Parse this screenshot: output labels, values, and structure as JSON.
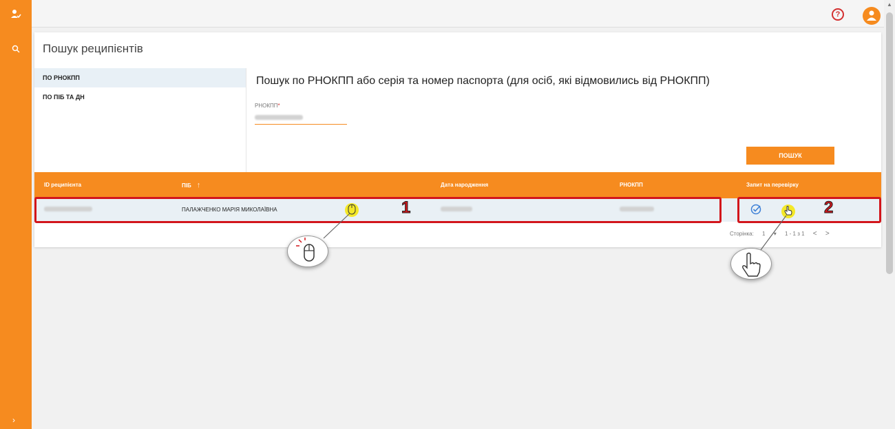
{
  "nav": {
    "search_icon": "search-icon",
    "expand_icon": "chevron-right-icon"
  },
  "header": {
    "help_label": "?",
    "avatar_icon": "user-icon"
  },
  "page": {
    "title": "Пошук реципієнтів"
  },
  "tabs": [
    {
      "label": "ПО РНОКПП",
      "active": true
    },
    {
      "label": "ПО ПІБ ТА ДН",
      "active": false
    }
  ],
  "search": {
    "heading": "Пошук по РНОКПП або серія та номер паспорта (для осіб, які відмовились від РНОКПП)",
    "field_label": "РНОКПП",
    "required_mark": "*",
    "button_label": "ПОШУК"
  },
  "table": {
    "columns": [
      "ID реципієнта",
      "ПІБ",
      "Дата народження",
      "РНОКПП",
      "Запит на перевірку"
    ],
    "sort_column": "ПІБ",
    "rows": [
      {
        "id": "",
        "name": "ПАЛАЖЧЕНКО МАРІЯ МИКОЛАЇВНА",
        "birth_date": "",
        "tax_id": ""
      }
    ]
  },
  "pagination": {
    "page_label": "Сторінка:",
    "page_value": "1",
    "range": "1 - 1 з 1",
    "prev": "<",
    "next": ">"
  },
  "annotations": {
    "callout_1": "1",
    "callout_2": "2",
    "accent": "#d2151b"
  },
  "colors": {
    "brand": "#f68b1f",
    "row_bg": "#e9f0f5",
    "check": "#3c7fd6"
  }
}
